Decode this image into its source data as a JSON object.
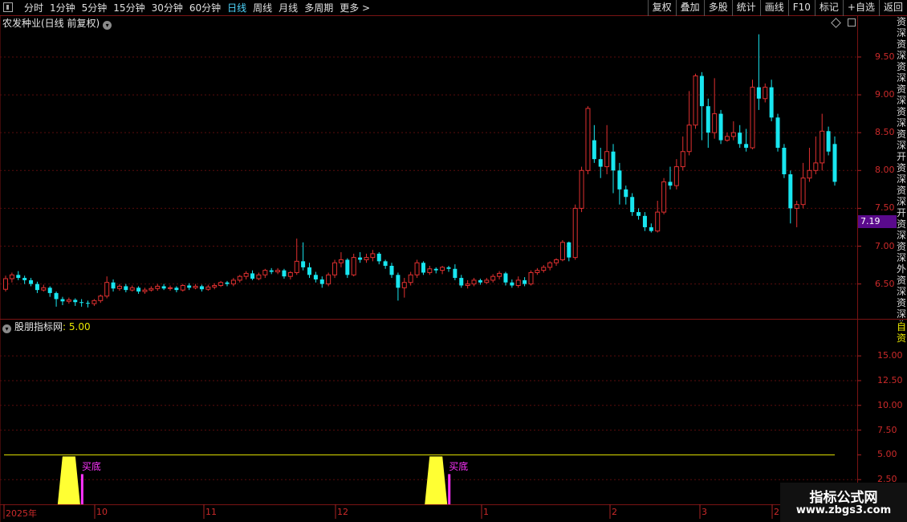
{
  "toolbar": {
    "periods": [
      "分时",
      "1分钟",
      "5分钟",
      "15分钟",
      "30分钟",
      "60分钟",
      "日线",
      "周线",
      "月线",
      "多周期",
      "更多 >"
    ],
    "active_period": "日线",
    "buttons": [
      "复权",
      "叠加",
      "多股",
      "统计",
      "画线",
      "F10",
      "标记",
      "+自选",
      "返回"
    ]
  },
  "stock": {
    "title": "农发种业(日线 前复权)"
  },
  "price_axis": {
    "labels": [
      "9.50",
      "9.00",
      "8.50",
      "8.00",
      "7.50",
      "7.00",
      "6.50"
    ],
    "current": "7.19"
  },
  "indicator": {
    "name": "股朋指标网",
    "value_label": ": 5.00",
    "axis_labels": [
      "15.00",
      "12.50",
      "10.00",
      "7.50",
      "5.00",
      "2.50"
    ],
    "signal_text": "买底"
  },
  "x_axis": {
    "labels": [
      "2025年",
      "10",
      "11",
      "12",
      "1",
      "2",
      "3",
      "2"
    ]
  },
  "right_strip": {
    "text": "资深资深资深资深资深资深开资深资深开资深资深外资深资深收",
    "text2": "自资"
  },
  "watermark": {
    "line1": "指标公式网",
    "line2": "www.zbgs3.com"
  },
  "colors": {
    "up": "#e03030",
    "down": "#18e6f0",
    "grid": "#5a0c0c",
    "accent": "#4fd7ff",
    "indicator_fill": "#ffff33",
    "signal": "#ff33ff"
  },
  "chart_data": {
    "type": "candlestick",
    "ylim": [
      6.05,
      9.85
    ],
    "candles": [
      [
        6.43,
        6.57,
        6.4,
        6.61
      ],
      [
        6.57,
        6.62,
        6.52,
        6.65
      ],
      [
        6.62,
        6.58,
        6.55,
        6.67
      ],
      [
        6.58,
        6.55,
        6.5,
        6.61
      ],
      [
        6.55,
        6.5,
        6.47,
        6.58
      ],
      [
        6.5,
        6.42,
        6.38,
        6.53
      ],
      [
        6.42,
        6.45,
        6.4,
        6.49
      ],
      [
        6.45,
        6.38,
        6.33,
        6.47
      ],
      [
        6.38,
        6.3,
        6.2,
        6.4
      ],
      [
        6.3,
        6.27,
        6.22,
        6.33
      ],
      [
        6.27,
        6.29,
        6.24,
        6.32
      ],
      [
        6.29,
        6.26,
        6.21,
        6.31
      ],
      [
        6.26,
        6.25,
        6.2,
        6.3
      ],
      [
        6.25,
        6.24,
        6.19,
        6.28
      ],
      [
        6.24,
        6.28,
        6.21,
        6.3
      ],
      [
        6.28,
        6.34,
        6.25,
        6.36
      ],
      [
        6.34,
        6.52,
        6.31,
        6.6
      ],
      [
        6.52,
        6.44,
        6.4,
        6.56
      ],
      [
        6.44,
        6.47,
        6.41,
        6.5
      ],
      [
        6.47,
        6.42,
        6.39,
        6.5
      ],
      [
        6.42,
        6.45,
        6.4,
        6.48
      ],
      [
        6.45,
        6.4,
        6.37,
        6.47
      ],
      [
        6.4,
        6.42,
        6.37,
        6.45
      ],
      [
        6.42,
        6.44,
        6.4,
        6.47
      ],
      [
        6.44,
        6.47,
        6.41,
        6.5
      ],
      [
        6.47,
        6.44,
        6.42,
        6.5
      ],
      [
        6.44,
        6.45,
        6.41,
        6.48
      ],
      [
        6.45,
        6.42,
        6.39,
        6.47
      ],
      [
        6.42,
        6.48,
        6.4,
        6.5
      ],
      [
        6.48,
        6.45,
        6.42,
        6.51
      ],
      [
        6.45,
        6.47,
        6.43,
        6.5
      ],
      [
        6.47,
        6.43,
        6.4,
        6.49
      ],
      [
        6.43,
        6.46,
        6.41,
        6.49
      ],
      [
        6.46,
        6.48,
        6.43,
        6.51
      ],
      [
        6.48,
        6.52,
        6.46,
        6.54
      ],
      [
        6.52,
        6.5,
        6.47,
        6.54
      ],
      [
        6.5,
        6.55,
        6.47,
        6.58
      ],
      [
        6.55,
        6.6,
        6.52,
        6.62
      ],
      [
        6.6,
        6.64,
        6.56,
        6.67
      ],
      [
        6.64,
        6.57,
        6.55,
        6.68
      ],
      [
        6.57,
        6.62,
        6.55,
        6.65
      ],
      [
        6.62,
        6.68,
        6.58,
        6.7
      ],
      [
        6.68,
        6.66,
        6.63,
        6.71
      ],
      [
        6.66,
        6.68,
        6.63,
        6.71
      ],
      [
        6.68,
        6.6,
        6.57,
        6.7
      ],
      [
        6.6,
        6.65,
        6.56,
        6.67
      ],
      [
        6.65,
        6.8,
        6.62,
        7.1
      ],
      [
        6.8,
        6.72,
        6.68,
        7.05
      ],
      [
        6.72,
        6.62,
        6.58,
        6.78
      ],
      [
        6.62,
        6.56,
        6.52,
        6.66
      ],
      [
        6.56,
        6.5,
        6.45,
        6.6
      ],
      [
        6.5,
        6.62,
        6.47,
        6.65
      ],
      [
        6.62,
        6.78,
        6.58,
        6.82
      ],
      [
        6.78,
        6.82,
        6.72,
        6.92
      ],
      [
        6.82,
        6.62,
        6.58,
        6.84
      ],
      [
        6.62,
        6.85,
        6.6,
        6.9
      ],
      [
        6.85,
        6.82,
        6.78,
        6.92
      ],
      [
        6.82,
        6.85,
        6.78,
        6.9
      ],
      [
        6.85,
        6.9,
        6.8,
        6.95
      ],
      [
        6.9,
        6.8,
        6.76,
        6.92
      ],
      [
        6.8,
        6.74,
        6.7,
        6.82
      ],
      [
        6.74,
        6.62,
        6.58,
        6.78
      ],
      [
        6.62,
        6.45,
        6.28,
        6.65
      ],
      [
        6.45,
        6.52,
        6.32,
        6.58
      ],
      [
        6.52,
        6.62,
        6.48,
        6.66
      ],
      [
        6.62,
        6.78,
        6.58,
        6.82
      ],
      [
        6.78,
        6.65,
        6.62,
        6.8
      ],
      [
        6.65,
        6.7,
        6.62,
        6.74
      ],
      [
        6.7,
        6.68,
        6.64,
        6.72
      ],
      [
        6.68,
        6.72,
        6.63,
        6.74
      ],
      [
        6.72,
        6.7,
        6.66,
        6.74
      ],
      [
        6.7,
        6.58,
        6.55,
        6.76
      ],
      [
        6.58,
        6.48,
        6.45,
        6.62
      ],
      [
        6.48,
        6.5,
        6.44,
        6.55
      ],
      [
        6.5,
        6.55,
        6.47,
        6.58
      ],
      [
        6.55,
        6.52,
        6.49,
        6.57
      ],
      [
        6.52,
        6.55,
        6.5,
        6.58
      ],
      [
        6.55,
        6.6,
        6.52,
        6.63
      ],
      [
        6.6,
        6.64,
        6.56,
        6.67
      ],
      [
        6.64,
        6.52,
        6.48,
        6.66
      ],
      [
        6.52,
        6.48,
        6.45,
        6.56
      ],
      [
        6.48,
        6.55,
        6.45,
        6.6
      ],
      [
        6.55,
        6.5,
        6.47,
        6.59
      ],
      [
        6.5,
        6.65,
        6.48,
        6.68
      ],
      [
        6.65,
        6.68,
        6.62,
        6.71
      ],
      [
        6.68,
        6.72,
        6.65,
        6.75
      ],
      [
        6.72,
        6.78,
        6.68,
        6.8
      ],
      [
        6.78,
        6.82,
        6.74,
        6.84
      ],
      [
        6.82,
        7.05,
        6.8,
        7.08
      ],
      [
        7.05,
        6.85,
        6.8,
        7.06
      ],
      [
        6.85,
        7.5,
        6.82,
        7.55
      ],
      [
        7.5,
        8.0,
        7.45,
        8.05
      ],
      [
        8.0,
        8.82,
        7.95,
        8.85
      ],
      [
        8.4,
        8.15,
        8.1,
        8.6
      ],
      [
        8.15,
        8.05,
        7.9,
        8.3
      ],
      [
        8.05,
        8.25,
        7.95,
        8.6
      ],
      [
        8.25,
        8.0,
        7.7,
        8.35
      ],
      [
        8.0,
        7.75,
        7.55,
        8.1
      ],
      [
        7.75,
        7.65,
        7.55,
        7.8
      ],
      [
        7.65,
        7.45,
        7.4,
        7.7
      ],
      [
        7.45,
        7.4,
        7.35,
        7.5
      ],
      [
        7.4,
        7.25,
        7.2,
        7.45
      ],
      [
        7.25,
        7.2,
        7.18,
        7.3
      ],
      [
        7.2,
        7.45,
        7.18,
        7.6
      ],
      [
        7.45,
        7.85,
        7.42,
        7.9
      ],
      [
        7.85,
        7.8,
        7.75,
        8.05
      ],
      [
        7.8,
        8.05,
        7.75,
        8.15
      ],
      [
        8.05,
        8.25,
        8.0,
        8.45
      ],
      [
        8.25,
        8.6,
        8.2,
        9.05
      ],
      [
        8.6,
        9.25,
        8.55,
        9.28
      ],
      [
        9.25,
        8.85,
        8.4,
        9.3
      ],
      [
        8.85,
        8.5,
        8.3,
        8.95
      ],
      [
        8.5,
        8.75,
        8.42,
        9.22
      ],
      [
        8.75,
        8.4,
        8.35,
        8.8
      ],
      [
        8.4,
        8.45,
        8.38,
        8.5
      ],
      [
        8.45,
        8.5,
        8.4,
        8.65
      ],
      [
        8.5,
        8.35,
        8.3,
        8.6
      ],
      [
        8.35,
        8.3,
        8.25,
        8.55
      ],
      [
        8.3,
        9.1,
        8.28,
        9.2
      ],
      [
        9.1,
        8.95,
        8.8,
        9.8
      ],
      [
        8.95,
        9.1,
        8.9,
        9.15
      ],
      [
        9.1,
        8.7,
        8.65,
        9.2
      ],
      [
        8.7,
        8.3,
        8.25,
        8.75
      ],
      [
        8.3,
        7.95,
        7.9,
        8.35
      ],
      [
        7.95,
        7.5,
        7.3,
        8.0
      ],
      [
        7.5,
        7.55,
        7.25,
        7.6
      ],
      [
        7.55,
        7.9,
        7.5,
        8.1
      ],
      [
        7.9,
        8.0,
        7.85,
        8.3
      ],
      [
        8.0,
        8.1,
        7.95,
        8.45
      ],
      [
        8.1,
        8.52,
        8.0,
        8.75
      ],
      [
        8.52,
        8.25,
        8.2,
        8.58
      ],
      [
        8.35,
        7.85,
        7.8,
        8.45
      ]
    ],
    "indicator": {
      "line_level": 5.0,
      "signals": [
        {
          "index": 10,
          "value": 5.0
        },
        {
          "index": 68,
          "value": 5.0
        }
      ],
      "ylim": [
        0,
        18.5
      ]
    }
  }
}
